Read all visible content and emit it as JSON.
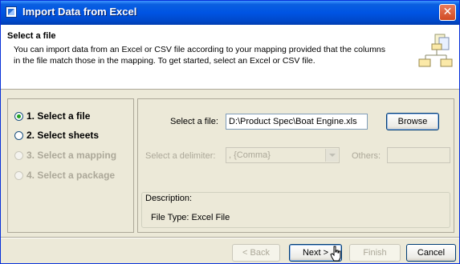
{
  "window": {
    "title": "Import Data from Excel",
    "close_glyph": "✕"
  },
  "header": {
    "title": "Select a file",
    "description": "You can import data from an Excel or CSV file according to your mapping provided that the columns in the file match those in the mapping. To get started, select an Excel or CSV file.",
    "illustration_icon": "hierarchy-diagram-icon"
  },
  "steps": [
    {
      "label": "1. Select a file",
      "checked": true,
      "enabled": true
    },
    {
      "label": "2. Select sheets",
      "checked": false,
      "enabled": true
    },
    {
      "label": "3. Select a mapping",
      "checked": false,
      "enabled": false
    },
    {
      "label": "4. Select a package",
      "checked": false,
      "enabled": false
    }
  ],
  "file": {
    "label": "Select a file:",
    "value": "D:\\Product Spec\\Boat Engine.xls",
    "browse_label": "Browse"
  },
  "delimiter": {
    "label": "Select a delimiter:",
    "value": ", {Comma}",
    "others_label": "Others:",
    "others_value": ""
  },
  "description": {
    "label": "Description:",
    "text": "File Type: Excel File"
  },
  "footer": {
    "back_label": "< Back",
    "next_label": "Next >",
    "finish_label": "Finish",
    "cancel_label": "Cancel"
  },
  "colors": {
    "titlebar": "#0054e3",
    "panel": "#ece9d8",
    "accent": "#003c74"
  }
}
